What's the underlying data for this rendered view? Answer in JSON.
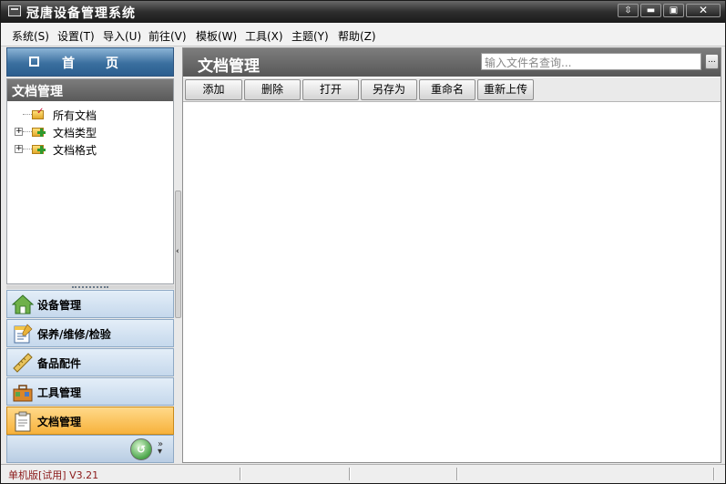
{
  "window": {
    "title": "冠唐设备管理系统",
    "controls": [
      "⇳",
      "▬",
      "▣",
      "✕"
    ]
  },
  "menu": [
    {
      "label": "系统(S)"
    },
    {
      "label": "设置(T)"
    },
    {
      "label": "导入(U)"
    },
    {
      "label": "前往(V)"
    },
    {
      "label": "模板(W)"
    },
    {
      "label": "工具(X)"
    },
    {
      "label": "主题(Y)"
    },
    {
      "label": "帮助(Z)"
    }
  ],
  "sidebar": {
    "home_label": "首页",
    "tree_title": "文档管理",
    "tree": [
      {
        "label": "所有文档",
        "icon": "folder-check-icon",
        "expandable": false
      },
      {
        "label": "文档类型",
        "icon": "folder-plus-icon",
        "expandable": true
      },
      {
        "label": "文档格式",
        "icon": "folder-plus-icon",
        "expandable": true
      }
    ],
    "nav": [
      {
        "label": "设备管理",
        "icon": "house-icon",
        "active": false
      },
      {
        "label": "保养/维修/检验",
        "icon": "checklist-icon",
        "active": false
      },
      {
        "label": "备品配件",
        "icon": "ruler-icon",
        "active": false
      },
      {
        "label": "工具管理",
        "icon": "toolbox-icon",
        "active": false
      },
      {
        "label": "文档管理",
        "icon": "clipboard-icon",
        "active": true
      }
    ]
  },
  "main": {
    "title": "文档管理",
    "search": {
      "placeholder": "输入文件名查询...",
      "button": "..."
    },
    "toolbar": [
      {
        "label": "添加"
      },
      {
        "label": "删除"
      },
      {
        "label": "打开"
      },
      {
        "label": "另存为"
      },
      {
        "label": "重命名"
      },
      {
        "label": "重新上传"
      }
    ]
  },
  "status": {
    "edition": "单机版[试用]  V3.21"
  },
  "colors": {
    "title_bar": "#2e2e2e",
    "home_button": "#3a6f9f",
    "active_nav": "#f7b23b",
    "status_text": "#8b1a1a"
  }
}
